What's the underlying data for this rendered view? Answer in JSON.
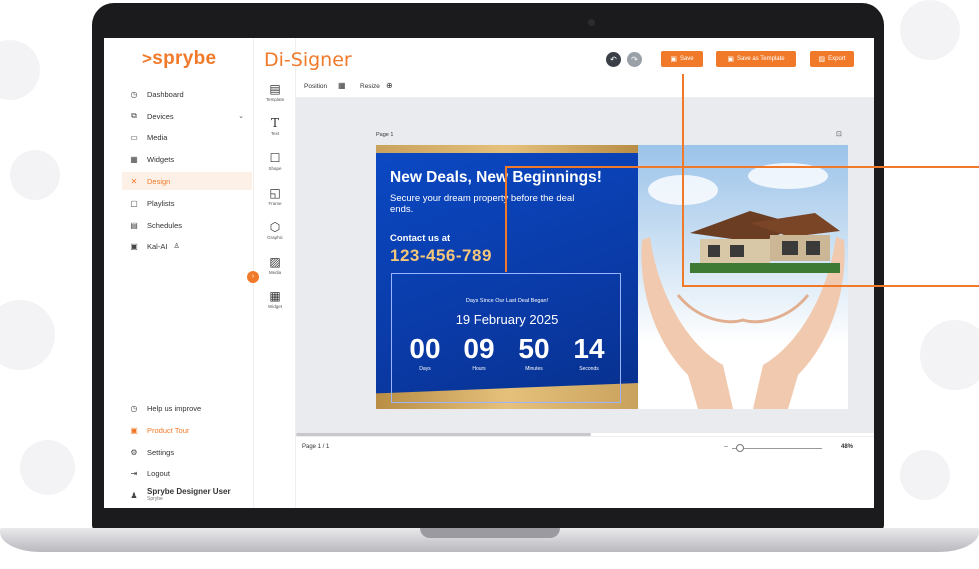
{
  "sidebar": {
    "logo": "sprybe",
    "items": [
      {
        "icon": "◷",
        "label": "Dashboard"
      },
      {
        "icon": "⧉",
        "label": "Devices"
      },
      {
        "icon": "▭",
        "label": "Media"
      },
      {
        "icon": "▦",
        "label": "Widgets"
      },
      {
        "icon": "✕",
        "label": "Design"
      },
      {
        "icon": "▢",
        "label": "Playlists"
      },
      {
        "icon": "▤",
        "label": "Schedules"
      },
      {
        "icon": "▣",
        "label": "Kal-AI"
      }
    ],
    "bottom": [
      {
        "icon": "◷",
        "label": "Help us improve"
      },
      {
        "icon": "▣",
        "label": "Product Tour"
      },
      {
        "icon": "⚙",
        "label": "Settings"
      },
      {
        "icon": "⇥",
        "label": "Logout"
      }
    ],
    "user": {
      "name": "Sprybe Designer User",
      "org": "Sprybe"
    }
  },
  "header": {
    "title": "Di-Signer",
    "save": "Save",
    "save_template": "Save as Template",
    "export": "Export"
  },
  "tools": [
    {
      "icon": "▤",
      "label": "Template"
    },
    {
      "icon": "T",
      "label": "Text"
    },
    {
      "icon": "☐",
      "label": "Shape"
    },
    {
      "icon": "◱",
      "label": "Frame"
    },
    {
      "icon": "⬡",
      "label": "Graphic"
    },
    {
      "icon": "▨",
      "label": "Media"
    },
    {
      "icon": "▦",
      "label": "Widget"
    }
  ],
  "toolbar": {
    "position": "Position",
    "resize": "Resize"
  },
  "page": {
    "label": "Page 1",
    "count": "Page 1 / 1",
    "zoom": "48%"
  },
  "design": {
    "headline": "New Deals, New Beginnings!",
    "subline": "Secure your dream property before the deal ends.",
    "contact": "Contact us at",
    "phone": "123-456-789",
    "countdown": {
      "caption": "Days Since Our Last Deal Began!",
      "date": "19 February 2025",
      "days": "00",
      "hours": "09",
      "minutes": "50",
      "seconds": "14",
      "days_label": "Days",
      "hours_label": "Hours",
      "minutes_label": "Minutes",
      "seconds_label": "Seconds"
    }
  },
  "colors": {
    "accent": "#f07a2a",
    "canvas_blue": "#0b49c4",
    "gold": "#e5c17c"
  }
}
